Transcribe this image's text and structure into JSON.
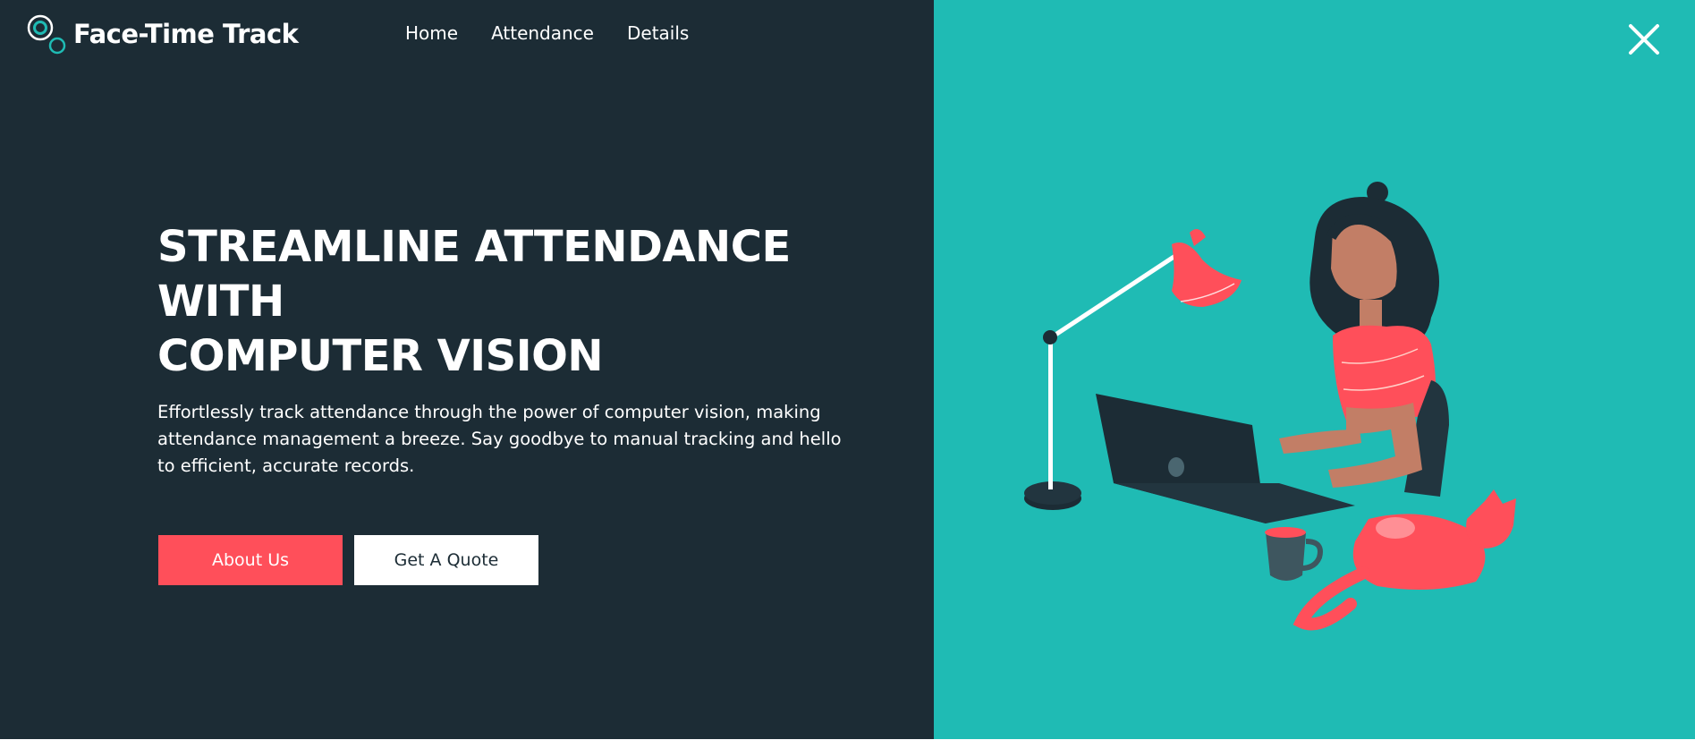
{
  "brand": {
    "name": "Face-Time Track",
    "logo_icon": "double-circle-logo-icon"
  },
  "nav": {
    "items": [
      {
        "label": "Home"
      },
      {
        "label": "Attendance"
      },
      {
        "label": "Details"
      }
    ]
  },
  "hero": {
    "title_lines": [
      "STREAMLINE ATTENDANCE",
      "WITH",
      "COMPUTER VISION"
    ],
    "description": "Effortlessly track attendance through the power of computer vision, making attendance management a breeze. Say goodbye to manual tracking and hello to efficient, accurate records.",
    "about_button": "About Us",
    "quote_button": "Get A Quote"
  },
  "close": {
    "icon": "close-icon"
  },
  "colors": {
    "dark_panel": "#1c2c35",
    "teal_panel": "#1fbbb4",
    "accent": "#ff4f5a",
    "white": "#ffffff"
  },
  "illustration": {
    "icon": "woman-at-laptop-illustration",
    "elements": [
      "desk-lamp",
      "laptop",
      "coffee-mug",
      "cat"
    ]
  }
}
